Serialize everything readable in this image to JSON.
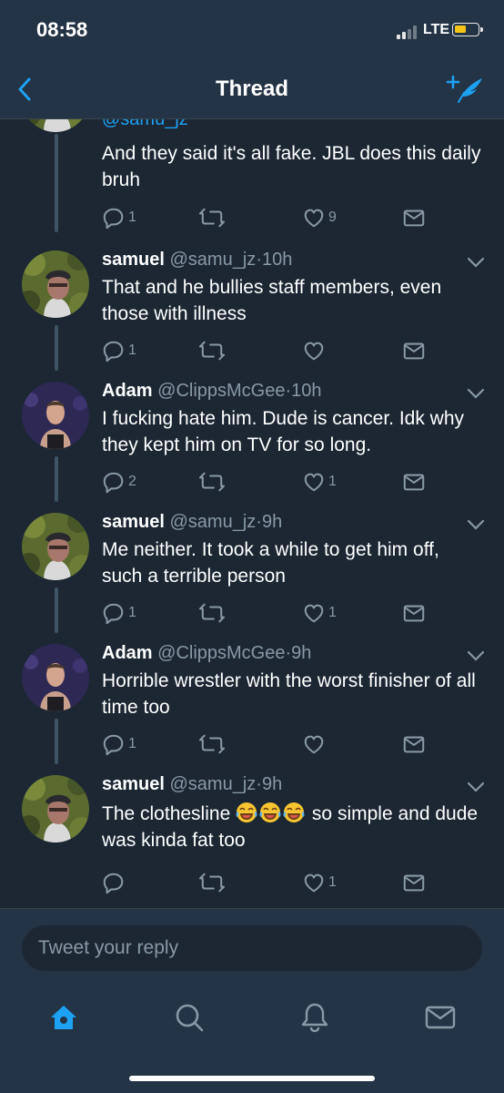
{
  "status_bar": {
    "time": "08:58",
    "network": "LTE"
  },
  "nav": {
    "title": "Thread",
    "back_icon": "chevron-left-icon",
    "compose_icon": "compose-tweet-icon"
  },
  "colors": {
    "background": "#1c2733",
    "bar": "#243447",
    "accent": "#1da1f2",
    "muted": "#8899a6",
    "battery": "#f5c518"
  },
  "tweets": [
    {
      "handle": "@samu_jz",
      "text": "And they said it's all fake. JBL does this daily bruh",
      "replies": "1",
      "retweets": "",
      "likes": "9"
    },
    {
      "name": "samuel",
      "handle": "@samu_jz",
      "time": "10h",
      "text": "That and he bullies staff members, even those with illness",
      "replies": "1",
      "retweets": "",
      "likes": ""
    },
    {
      "name": "Adam",
      "handle": "@ClippsMcGee",
      "time": "10h",
      "text": "I fucking hate him. Dude is cancer. Idk why they kept him on TV for so long.",
      "replies": "2",
      "retweets": "",
      "likes": "1"
    },
    {
      "name": "samuel",
      "handle": "@samu_jz",
      "time": "9h",
      "text": "Me neither. It took a while to get him off, such a terrible person",
      "replies": "1",
      "retweets": "",
      "likes": "1"
    },
    {
      "name": "Adam",
      "handle": "@ClippsMcGee",
      "time": "9h",
      "text": "Horrible wrestler with the worst finisher of all time too",
      "replies": "1",
      "retweets": "",
      "likes": ""
    },
    {
      "name": "samuel",
      "handle": "@samu_jz",
      "time": "9h",
      "text_before": "The clothesline",
      "text_after": " so simple and dude was kinda fat too",
      "emoji": "face-with-tears-of-joy x3",
      "replies": "",
      "retweets": "",
      "likes": "1"
    }
  ],
  "reply": {
    "placeholder": "Tweet your reply"
  },
  "tabs": [
    {
      "icon": "home-icon",
      "active": true
    },
    {
      "icon": "search-icon",
      "active": false
    },
    {
      "icon": "notifications-bell-icon",
      "active": false
    },
    {
      "icon": "messages-envelope-icon",
      "active": false
    }
  ]
}
